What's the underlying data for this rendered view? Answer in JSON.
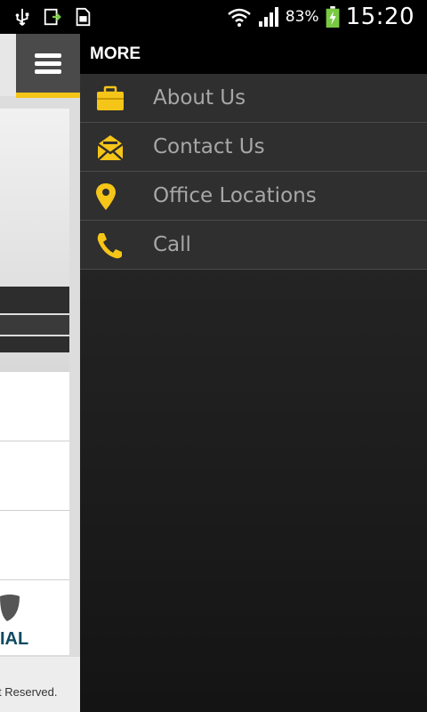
{
  "status_bar": {
    "battery_percent": "83%",
    "time": "15:20",
    "icons": [
      "usb-icon",
      "download-icon",
      "sim-icon",
      "wifi-icon",
      "signal-icon",
      "battery-charging-icon"
    ]
  },
  "background_page": {
    "logo_text": "IAL",
    "footer_text": "t Reserved."
  },
  "drawer": {
    "title": "MORE",
    "items": [
      {
        "label": "About Us",
        "icon": "briefcase-icon"
      },
      {
        "label": "Contact Us",
        "icon": "envelope-icon"
      },
      {
        "label": "Office Locations",
        "icon": "location-pin-icon"
      },
      {
        "label": "Call",
        "icon": "phone-icon"
      }
    ]
  },
  "colors": {
    "accent": "#f5c518",
    "drawer_bg": "#1c1c1c",
    "label_text": "#a7a7a7"
  }
}
